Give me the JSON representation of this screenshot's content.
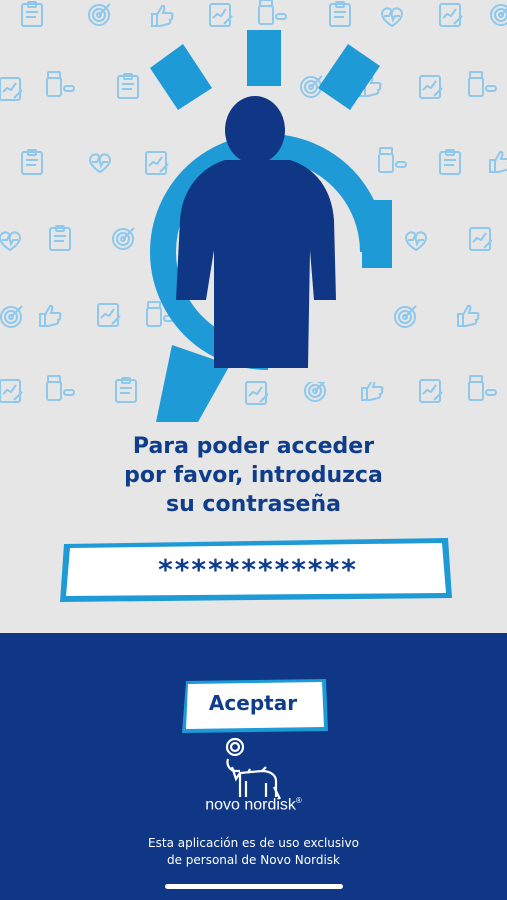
{
  "login": {
    "prompt_line1": "Para poder acceder",
    "prompt_line2": "por favor, introduzca",
    "prompt_line3": "su contraseña",
    "password_value": "************"
  },
  "actions": {
    "accept_label": "Aceptar"
  },
  "footer": {
    "brand_name": "novo nordisk",
    "brand_mark": "®",
    "disclaimer_line1": "Esta aplicación es de uso exclusivo",
    "disclaimer_line2": "de personal de Novo Nordisk"
  },
  "colors": {
    "background": "#e6e6e6",
    "navy": "#0f3786",
    "brand_blue": "#1e9ad6",
    "text_navy": "#0f3d8a"
  }
}
